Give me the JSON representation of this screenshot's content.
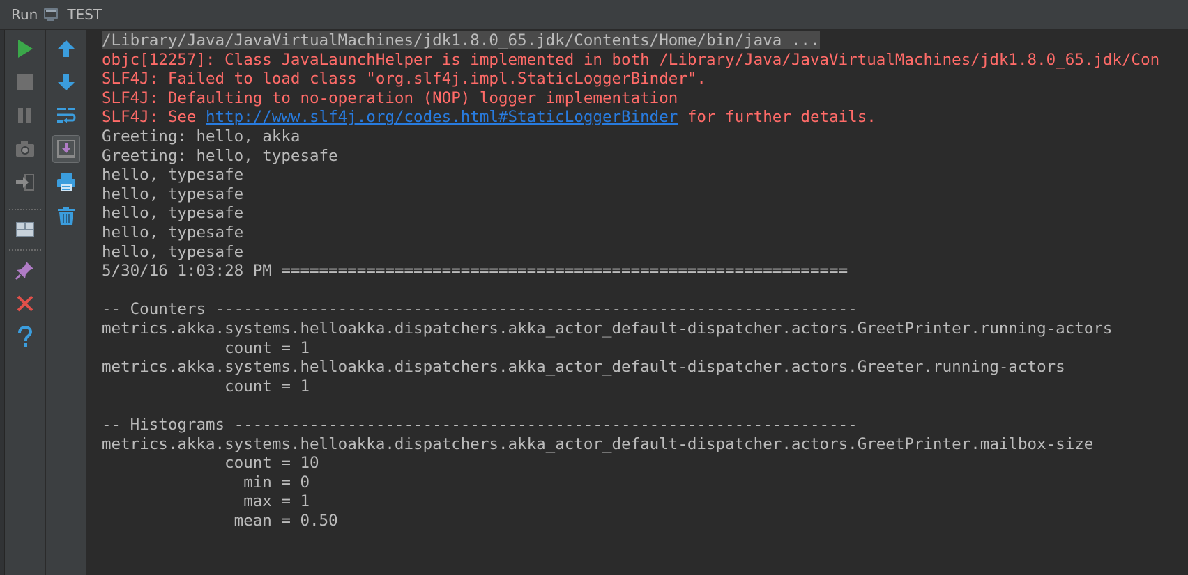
{
  "header": {
    "title": "Run",
    "config_icon": "run-config-icon",
    "config_name": "TEST"
  },
  "toolbar_left": [
    {
      "name": "rerun-icon",
      "color": "#3ba84a"
    },
    {
      "name": "stop-icon",
      "color": "#6e6e6e"
    },
    {
      "name": "pause-icon",
      "color": "#6e6e6e"
    },
    {
      "name": "camera-icon",
      "color": "#6e6e6e"
    },
    {
      "name": "login-icon",
      "color": "#6e6e6e"
    },
    {
      "name": "layout-icon",
      "color": "#7a8a99"
    },
    {
      "name": "pin-icon",
      "color": "#b07cc6"
    },
    {
      "name": "close-icon",
      "color": "#e0504a"
    },
    {
      "name": "help-icon",
      "color": "#3b9ddd"
    }
  ],
  "toolbar_right": [
    {
      "name": "up-arrow-icon",
      "color": "#3b9ddd"
    },
    {
      "name": "down-arrow-icon",
      "color": "#3b9ddd"
    },
    {
      "name": "soft-wrap-icon",
      "color": "#3b9ddd"
    },
    {
      "name": "scroll-to-end-icon",
      "color": "#b07cc6"
    },
    {
      "name": "print-icon",
      "color": "#3b9ddd"
    },
    {
      "name": "trash-icon",
      "color": "#3b9ddd"
    }
  ],
  "console": {
    "cmd": "/Library/Java/JavaVirtualMachines/jdk1.8.0_65.jdk/Contents/Home/bin/java ...",
    "err1": "objc[12257]: Class JavaLaunchHelper is implemented in both /Library/Java/JavaVirtualMachines/jdk1.8.0_65.jdk/Con",
    "err2": "SLF4J: Failed to load class \"org.slf4j.impl.StaticLoggerBinder\".",
    "err3": "SLF4J: Defaulting to no-operation (NOP) logger implementation",
    "err4_prefix": "SLF4J: See ",
    "err4_link": "http://www.slf4j.org/codes.html#StaticLoggerBinder",
    "err4_suffix": " for further details.",
    "out": [
      "Greeting: hello, akka",
      "Greeting: hello, typesafe",
      "hello, typesafe",
      "hello, typesafe",
      "hello, typesafe",
      "hello, typesafe",
      "hello, typesafe",
      "5/30/16 1:03:28 PM ============================================================",
      "",
      "-- Counters --------------------------------------------------------------------",
      "metrics.akka.systems.helloakka.dispatchers.akka_actor_default-dispatcher.actors.GreetPrinter.running-actors",
      "             count = 1",
      "metrics.akka.systems.helloakka.dispatchers.akka_actor_default-dispatcher.actors.Greeter.running-actors",
      "             count = 1",
      "",
      "-- Histograms ------------------------------------------------------------------",
      "metrics.akka.systems.helloakka.dispatchers.akka_actor_default-dispatcher.actors.GreetPrinter.mailbox-size",
      "             count = 10",
      "               min = 0",
      "               max = 1",
      "              mean = 0.50"
    ]
  }
}
